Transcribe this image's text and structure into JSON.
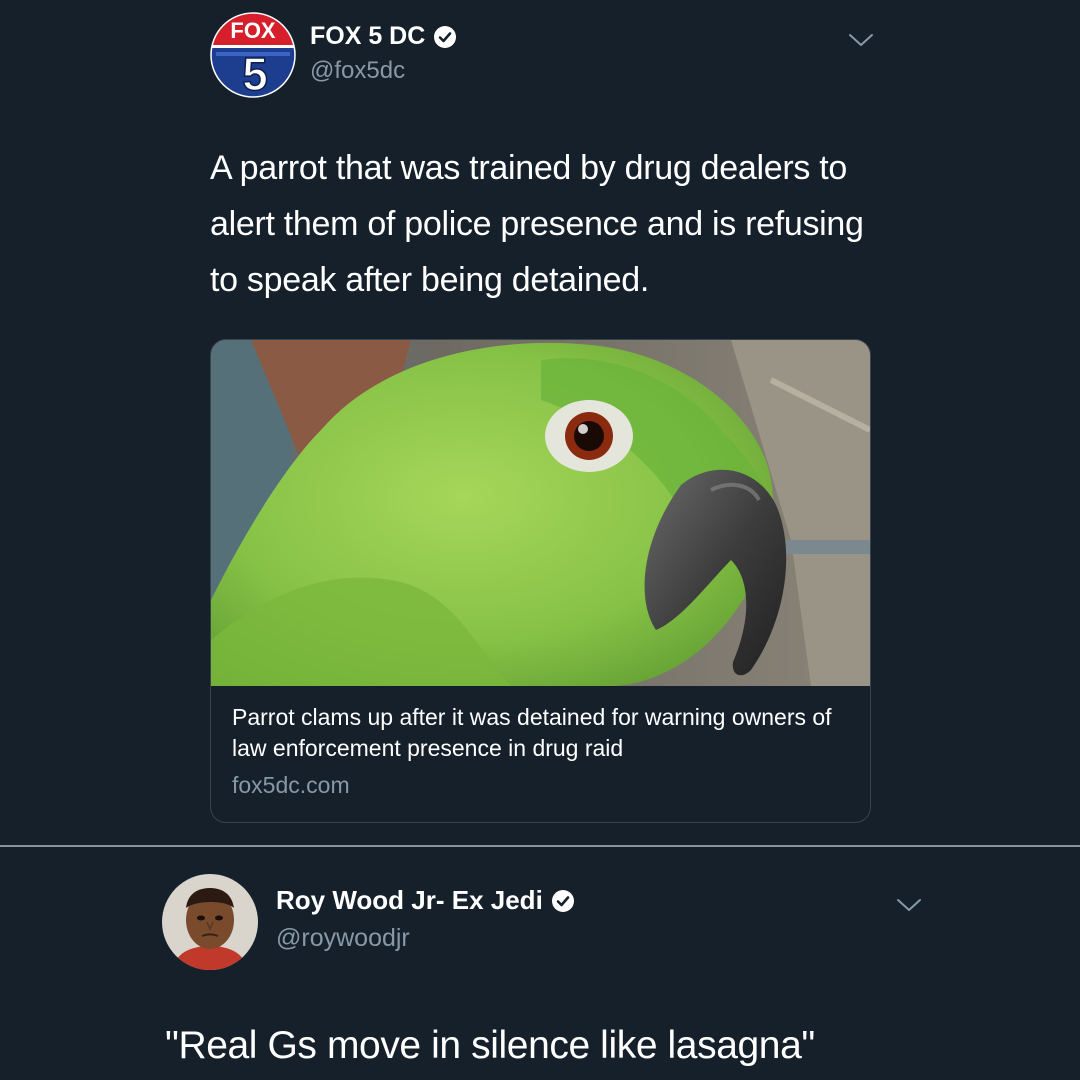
{
  "tweet1": {
    "avatar_text_top": "FOX",
    "avatar_text_number": "5",
    "display_name": "FOX 5 DC",
    "handle": "@fox5dc",
    "text": "A parrot that was trained by drug dealers to alert them of police presence and is refusing to speak after being detained.",
    "card": {
      "title": "Parrot clams up after it was detained for warning owners of law enforcement presence in drug raid",
      "domain": "fox5dc.com"
    },
    "icons": [
      "verified-icon",
      "chevron-down-icon"
    ]
  },
  "tweet2": {
    "display_name": "Roy Wood Jr- Ex Jedi",
    "handle": "@roywoodjr",
    "text": "\"Real Gs move in silence like lasagna\"",
    "icons": [
      "verified-icon",
      "chevron-down-icon"
    ]
  },
  "colors": {
    "background": "#15202b",
    "text_primary": "#ffffff",
    "text_secondary": "#8899a6",
    "border": "#38444d",
    "fox_red": "#d5202b",
    "fox_blue": "#1d3d8f"
  }
}
